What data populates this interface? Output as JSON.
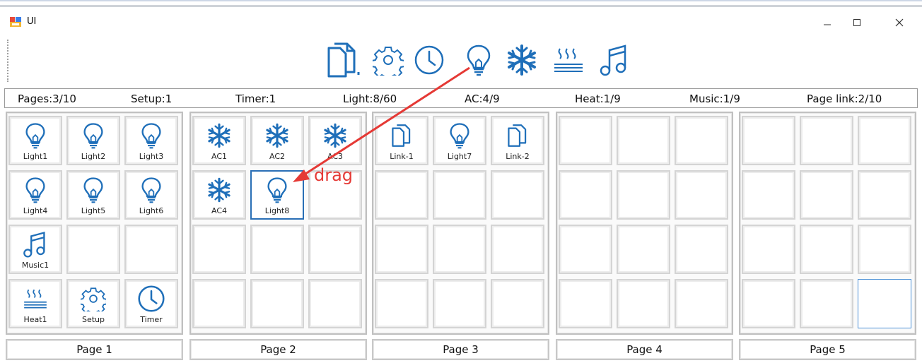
{
  "window": {
    "title": "UI"
  },
  "colors": {
    "accent": "#1f6fb9",
    "drag_arrow": "#e53935",
    "selection": "#2a6fb6"
  },
  "toolbar": {
    "icons": [
      "page-link-icon",
      "settings-gear-icon",
      "timer-clock-icon",
      "light-bulb-icon",
      "ac-snowflake-icon",
      "heat-icon",
      "music-note-icon"
    ]
  },
  "status": {
    "pages": "Pages:3/10",
    "setup": "Setup:1",
    "timer": "Timer:1",
    "light": "Light:8/60",
    "ac": "AC:4/9",
    "heat": "Heat:1/9",
    "music": "Music:1/9",
    "page_link": "Page link:2/10"
  },
  "pages": [
    {
      "label": "Page 1",
      "cells": [
        {
          "type": "light",
          "label": "Light1"
        },
        {
          "type": "light",
          "label": "Light2"
        },
        {
          "type": "light",
          "label": "Light3"
        },
        {
          "type": "light",
          "label": "Light4"
        },
        {
          "type": "light",
          "label": "Light5"
        },
        {
          "type": "light",
          "label": "Light6"
        },
        {
          "type": "music",
          "label": "Music1"
        },
        {
          "type": "",
          "label": ""
        },
        {
          "type": "",
          "label": ""
        },
        {
          "type": "heat",
          "label": "Heat1"
        },
        {
          "type": "gear",
          "label": "Setup"
        },
        {
          "type": "clock",
          "label": "Timer"
        }
      ]
    },
    {
      "label": "Page 2",
      "cells": [
        {
          "type": "ac",
          "label": "AC1"
        },
        {
          "type": "ac",
          "label": "AC2"
        },
        {
          "type": "ac",
          "label": "AC3"
        },
        {
          "type": "ac",
          "label": "AC4"
        },
        {
          "type": "light",
          "label": "Light8",
          "selected": true
        },
        {
          "type": "",
          "label": ""
        },
        {
          "type": "",
          "label": ""
        },
        {
          "type": "",
          "label": ""
        },
        {
          "type": "",
          "label": ""
        },
        {
          "type": "",
          "label": ""
        },
        {
          "type": "",
          "label": ""
        },
        {
          "type": "",
          "label": ""
        }
      ]
    },
    {
      "label": "Page 3",
      "cells": [
        {
          "type": "link",
          "label": "Link-1"
        },
        {
          "type": "light",
          "label": "Light7"
        },
        {
          "type": "link",
          "label": "Link-2"
        },
        {
          "type": "",
          "label": ""
        },
        {
          "type": "",
          "label": ""
        },
        {
          "type": "",
          "label": ""
        },
        {
          "type": "",
          "label": ""
        },
        {
          "type": "",
          "label": ""
        },
        {
          "type": "",
          "label": ""
        },
        {
          "type": "",
          "label": ""
        },
        {
          "type": "",
          "label": ""
        },
        {
          "type": "",
          "label": ""
        }
      ]
    },
    {
      "label": "Page 4",
      "cells": [
        {
          "type": "",
          "label": ""
        },
        {
          "type": "",
          "label": ""
        },
        {
          "type": "",
          "label": ""
        },
        {
          "type": "",
          "label": ""
        },
        {
          "type": "",
          "label": ""
        },
        {
          "type": "",
          "label": ""
        },
        {
          "type": "",
          "label": ""
        },
        {
          "type": "",
          "label": ""
        },
        {
          "type": "",
          "label": ""
        },
        {
          "type": "",
          "label": ""
        },
        {
          "type": "",
          "label": ""
        },
        {
          "type": "",
          "label": ""
        }
      ]
    },
    {
      "label": "Page 5",
      "cells": [
        {
          "type": "",
          "label": ""
        },
        {
          "type": "",
          "label": ""
        },
        {
          "type": "",
          "label": ""
        },
        {
          "type": "",
          "label": ""
        },
        {
          "type": "",
          "label": ""
        },
        {
          "type": "",
          "label": ""
        },
        {
          "type": "",
          "label": ""
        },
        {
          "type": "",
          "label": ""
        },
        {
          "type": "",
          "label": ""
        },
        {
          "type": "",
          "label": ""
        },
        {
          "type": "",
          "label": ""
        },
        {
          "type": "",
          "label": "",
          "selected_blue": true
        }
      ]
    }
  ],
  "annotation": {
    "drag_label": "drag"
  }
}
